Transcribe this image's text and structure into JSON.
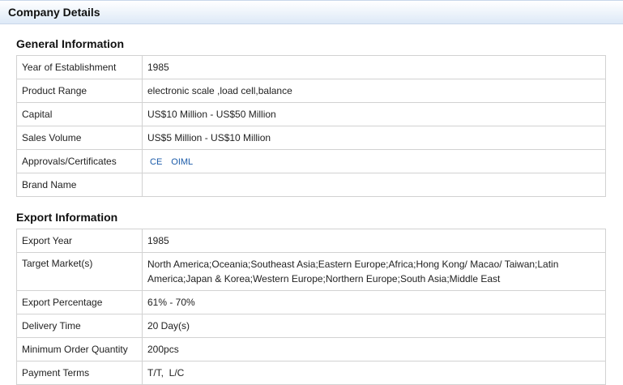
{
  "header": {
    "title": "Company Details"
  },
  "general": {
    "title": "General Information",
    "rows": [
      {
        "label": "Year of Establishment",
        "value": "1985"
      },
      {
        "label": "Product Range",
        "value": "electronic scale ,load cell,balance"
      },
      {
        "label": "Capital",
        "value": "US$10 Million - US$50 Million"
      },
      {
        "label": "Sales Volume",
        "value": "US$5 Million - US$10 Million"
      },
      {
        "label": "Approvals/Certificates",
        "certificates": [
          "CE",
          "OIML"
        ]
      },
      {
        "label": "Brand Name",
        "value": ""
      }
    ]
  },
  "export": {
    "title": "Export Information",
    "rows": [
      {
        "label": "Export Year",
        "value": "1985"
      },
      {
        "label": "Target Market(s)",
        "value": "North America;Oceania;Southeast Asia;Eastern Europe;Africa;Hong Kong/ Macao/ Taiwan;Latin America;Japan & Korea;Western Europe;Northern Europe;South Asia;Middle East"
      },
      {
        "label": "Export Percentage",
        "value": "61% - 70%"
      },
      {
        "label": "Delivery Time",
        "value": "20 Day(s)"
      },
      {
        "label": "Minimum Order Quantity",
        "value": "200pcs"
      },
      {
        "label": "Payment Terms",
        "value": "T/T,  L/C"
      }
    ]
  }
}
